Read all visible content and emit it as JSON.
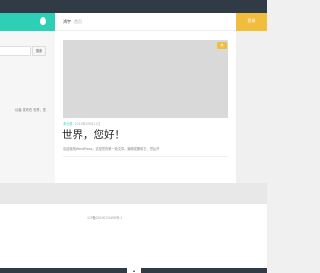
{
  "header": {
    "login_label": "登录"
  },
  "breadcrumb": {
    "home": "鸿宇",
    "current": "首页"
  },
  "sidebar": {
    "search_button": "搜索",
    "search_placeholder": "",
    "text": "仙者 发布在 世界，您"
  },
  "post": {
    "tag": "热",
    "category": "未分类",
    "date": "2019年09月11日",
    "title": "世界，您好！",
    "excerpt": "欢迎使用WordPress。这是您的第一篇文章。编辑或删除它，然后开"
  },
  "footer": {
    "icp": "ICP备2019123456号-1"
  },
  "colors": {
    "topbar": "#313b45",
    "accent_teal": "#2fcfb5",
    "accent_yellow": "#f0bd3d"
  }
}
